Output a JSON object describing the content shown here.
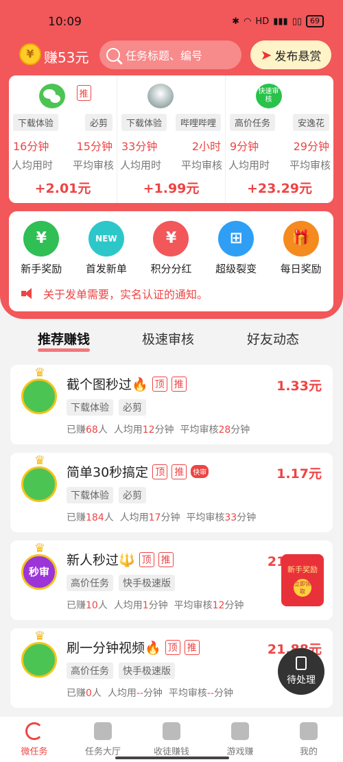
{
  "status": {
    "time": "10:09",
    "battery": "69"
  },
  "top": {
    "earn_label": "赚53元",
    "search_placeholder": "任务标题、编号",
    "publish_label": "发布悬赏"
  },
  "featured": [
    {
      "tag1": "下载体验",
      "tag2": "必剪",
      "avg_time": "16分钟",
      "avg_review": "15分钟",
      "reward": "+2.01元",
      "badge": "推"
    },
    {
      "tag1": "下载体验",
      "tag2": "哔哩哔哩",
      "avg_time": "33分钟",
      "avg_review": "2小时",
      "reward": "+1.99元"
    },
    {
      "tag1": "高价任务",
      "tag2": "安逸花",
      "avg_time": "9分钟",
      "avg_review": "29分钟",
      "reward": "+23.29元",
      "logo_text": "快速审核"
    }
  ],
  "featured_labels": {
    "avg_time": "人均用时",
    "avg_review": "平均审核"
  },
  "menu": [
    {
      "label": "新手奖励",
      "color": "#2fbf55",
      "glyph": "¥"
    },
    {
      "label": "首发新单",
      "color": "#2ec7c9",
      "glyph": "NEW"
    },
    {
      "label": "积分分红",
      "color": "#f2575a",
      "glyph": "¥"
    },
    {
      "label": "超级裂变",
      "color": "#2e9ff5",
      "glyph": "⊞"
    },
    {
      "label": "每日奖励",
      "color": "#f58a1f",
      "glyph": "🎁"
    }
  ],
  "notice": "关于发单需要，实名认证的通知。",
  "tabs": [
    "推荐赚钱",
    "极速审核",
    "好友动态"
  ],
  "list": [
    {
      "title": "截个图秒过🔥",
      "badges": [
        "顶",
        "推"
      ],
      "fast": "",
      "price": "1.33元",
      "tags": [
        "下载体验",
        "必剪"
      ],
      "earned": "68",
      "avg_time": "12",
      "avg_review": "28"
    },
    {
      "title": "简单30秒搞定",
      "badges": [
        "顶",
        "推"
      ],
      "fast": "快审",
      "price": "1.17元",
      "tags": [
        "下载体验",
        "必剪"
      ],
      "earned": "184",
      "avg_time": "17",
      "avg_review": "33"
    },
    {
      "title": "新人秒过🔱",
      "badges": [
        "顶",
        "推"
      ],
      "fast": "",
      "price": "21.88元",
      "tags": [
        "高价任务",
        "快手极速版"
      ],
      "earned": "10",
      "avg_time": "1",
      "avg_review": "12",
      "avatar_text": "秒审"
    },
    {
      "title": "刷一分钟视频🔥",
      "badges": [
        "顶",
        "推"
      ],
      "fast": "",
      "price": "21.88元",
      "tags": [
        "高价任务",
        "快手极速版"
      ],
      "earned": "0",
      "avg_time": "--",
      "avg_review": "--"
    }
  ],
  "stat_words": {
    "earned": "已赚",
    "people": "人",
    "avg_use": "人均用",
    "minutes": "分钟",
    "avg_review": "平均审核"
  },
  "float_reward": {
    "title": "新手奖励",
    "btn": "立即领取"
  },
  "pending": "待处理",
  "bottom": [
    "微任务",
    "任务大厅",
    "收徒赚钱",
    "游戏赚",
    "我的"
  ]
}
